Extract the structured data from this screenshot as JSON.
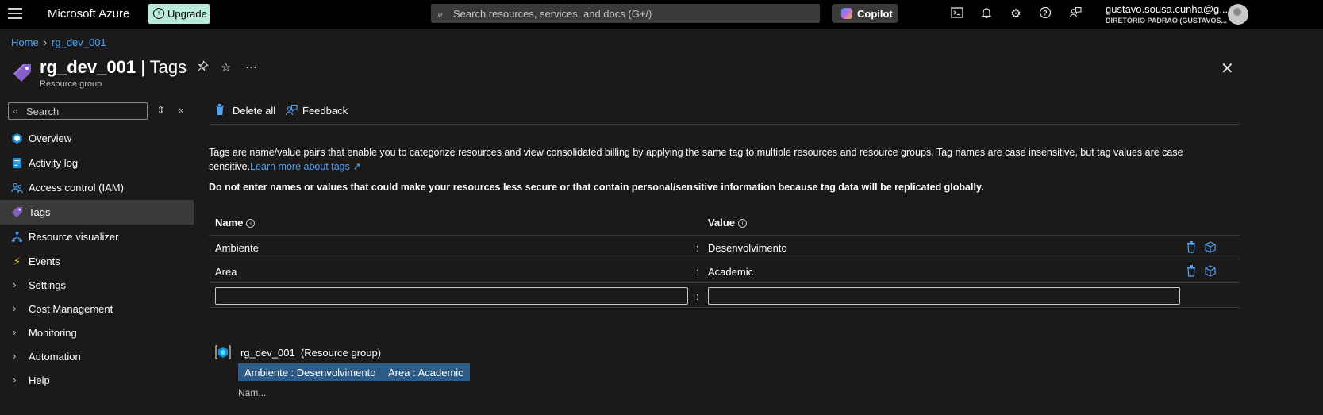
{
  "topbar": {
    "brand": "Microsoft Azure",
    "upgrade_label": "Upgrade",
    "search_placeholder": "Search resources, services, and docs (G+/)",
    "copilot_label": "Copilot",
    "account_name": "gustavo.sousa.cunha@g...",
    "account_directory": "DIRETÓRIO PADRÃO (GUSTAVOS...",
    "icons": [
      "cloud-shell-icon",
      "bell-icon",
      "gear-icon",
      "help-icon",
      "feedback-icon"
    ]
  },
  "breadcrumb": [
    "Home",
    "rg_dev_001"
  ],
  "header": {
    "resource_name": "rg_dev_001",
    "title_separator": "|",
    "page_name": "Tags",
    "subtitle": "Resource group"
  },
  "sidebar": {
    "search_placeholder": "Search",
    "items": [
      {
        "label": "Overview",
        "icon": "overview-icon",
        "active": false
      },
      {
        "label": "Activity log",
        "icon": "activity-log-icon",
        "active": false
      },
      {
        "label": "Access control (IAM)",
        "icon": "iam-icon",
        "active": false
      },
      {
        "label": "Tags",
        "icon": "tag-icon",
        "active": true
      },
      {
        "label": "Resource visualizer",
        "icon": "visualizer-icon",
        "active": false
      },
      {
        "label": "Events",
        "icon": "events-icon",
        "active": false
      },
      {
        "label": "Settings",
        "icon": "chevron-right-icon",
        "active": false
      },
      {
        "label": "Cost Management",
        "icon": "chevron-right-icon",
        "active": false
      },
      {
        "label": "Monitoring",
        "icon": "chevron-right-icon",
        "active": false
      },
      {
        "label": "Automation",
        "icon": "chevron-right-icon",
        "active": false
      },
      {
        "label": "Help",
        "icon": "chevron-right-icon",
        "active": false
      }
    ]
  },
  "toolbar": {
    "delete_all": "Delete all",
    "feedback": "Feedback"
  },
  "content": {
    "description": "Tags are name/value pairs that enable you to categorize resources and view consolidated billing by applying the same tag to multiple resources and resource groups. Tag names are case insensitive, but tag values are case sensitive.",
    "learn_more": "Learn more about tags",
    "warning": "Do not enter names or values that could make your resources less secure or that contain personal/sensitive information because tag data will be replicated globally."
  },
  "tags_table": {
    "name_header": "Name",
    "value_header": "Value",
    "separator": ":",
    "rows": [
      {
        "name": "Ambiente",
        "value": "Desenvolvimento"
      },
      {
        "name": "Area",
        "value": "Academic"
      }
    ],
    "new_name": "",
    "new_value": ""
  },
  "summary": {
    "resource_name": "rg_dev_001",
    "resource_type": "(Resource group)",
    "chips": [
      "Ambiente : Desenvolvimento",
      "Area : Academic"
    ],
    "cut_text": "Nam..."
  },
  "colors": {
    "accent": "#4fa3f7",
    "chip_bg": "#2e5c88",
    "upgrade_bg": "#b9ebd9",
    "background": "#1b1a19"
  }
}
